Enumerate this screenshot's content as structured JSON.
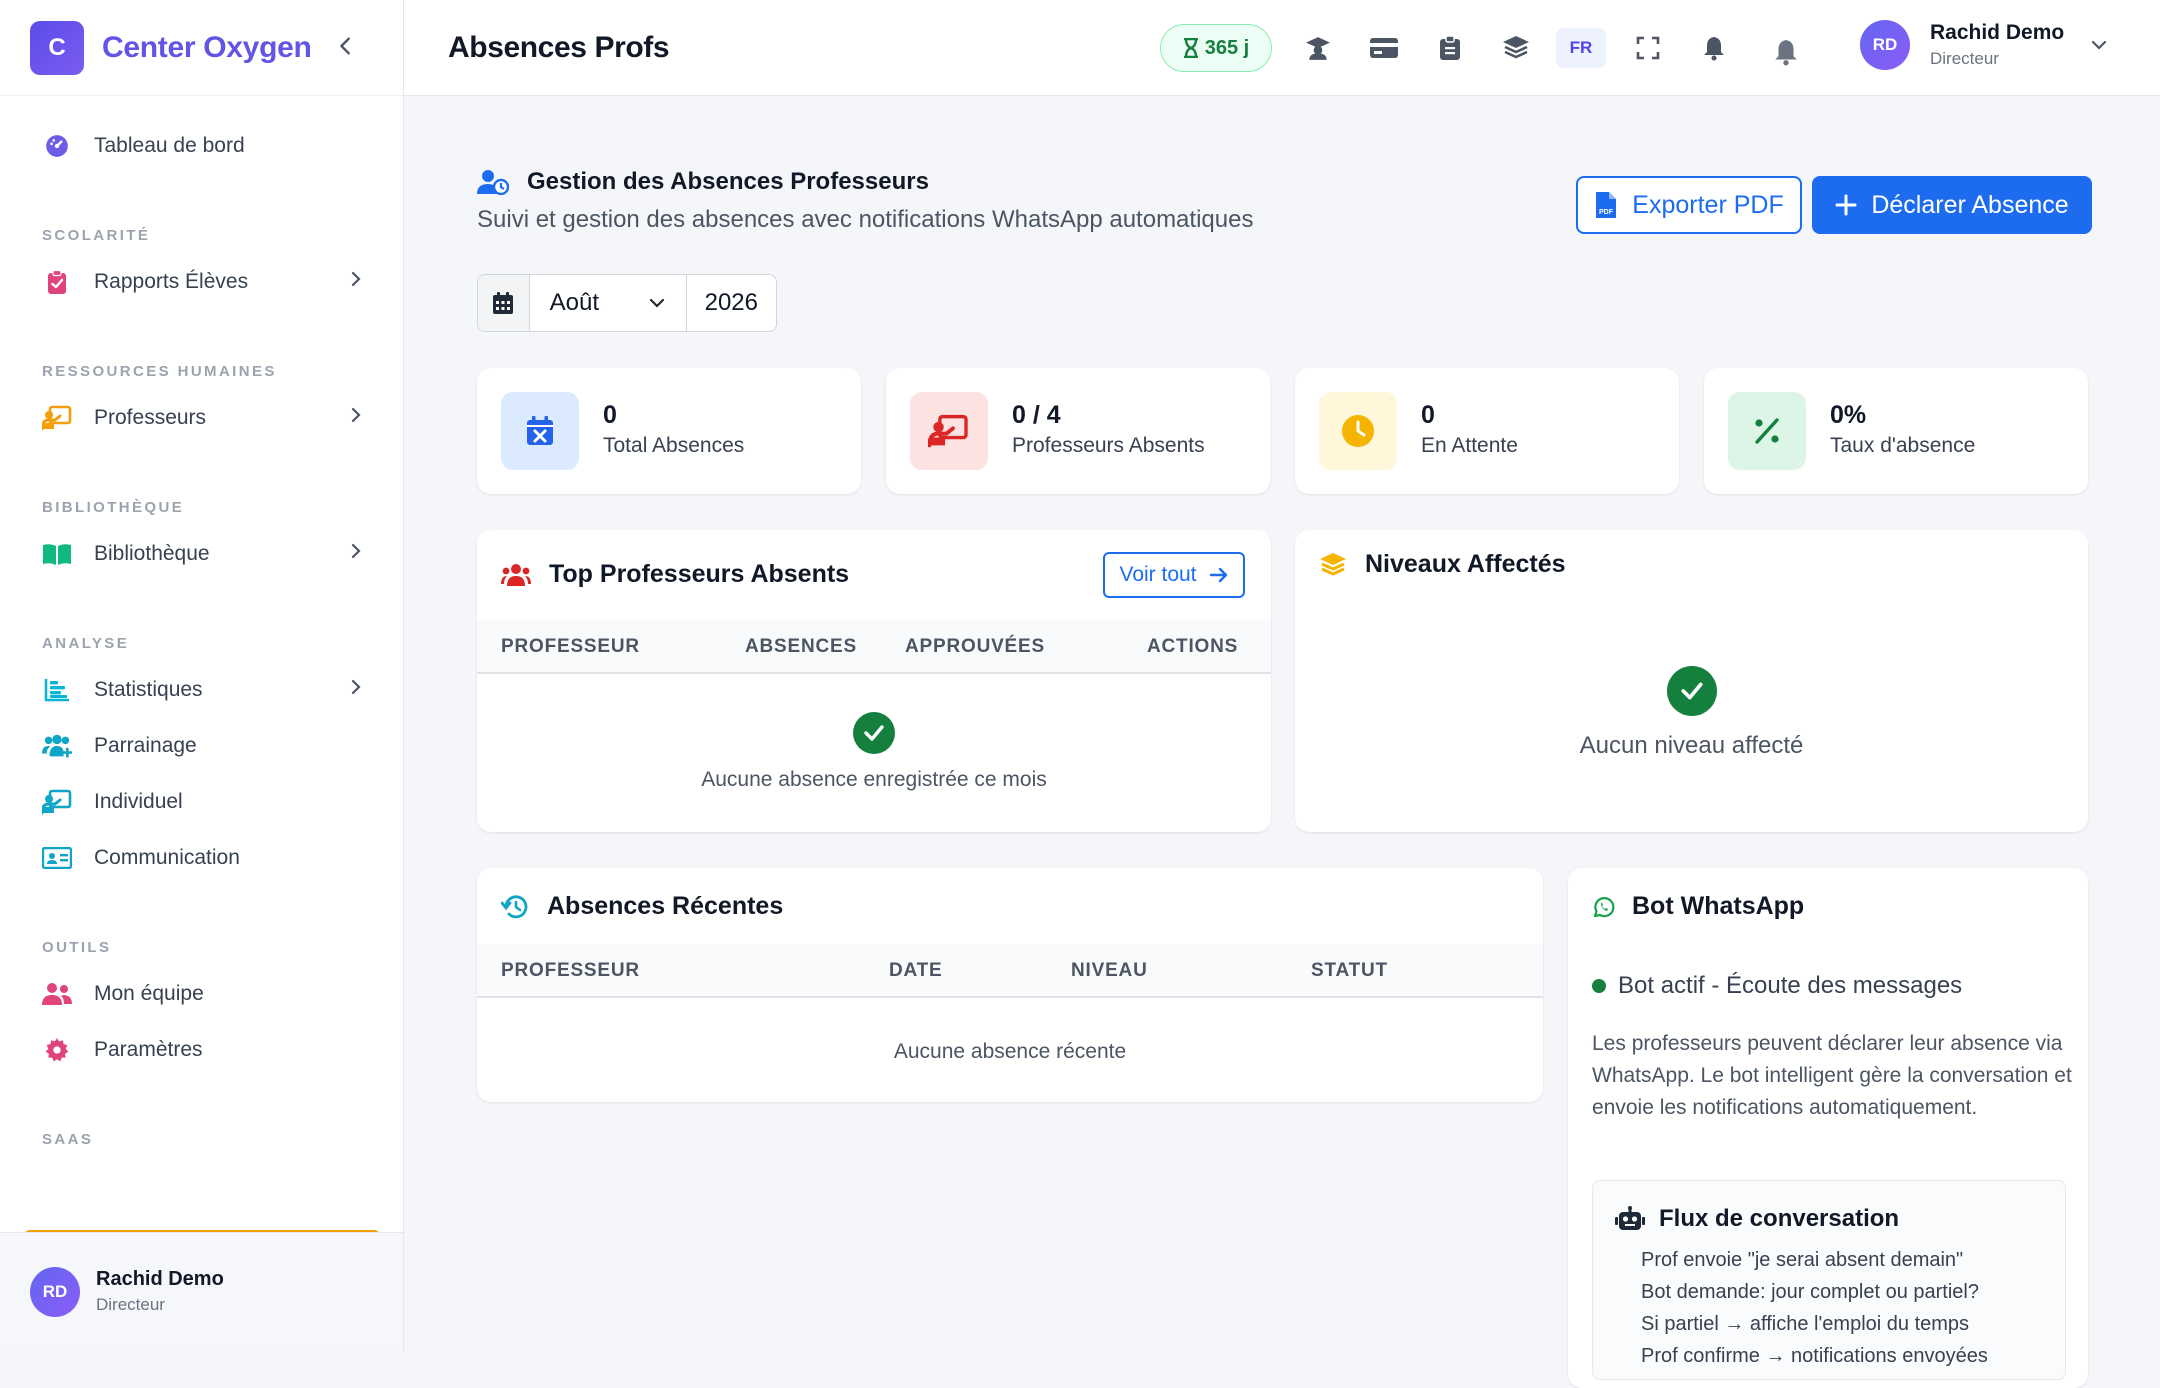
{
  "brand": {
    "initial": "C",
    "name": "Center Oxygen"
  },
  "sidebar": {
    "dashboard": "Tableau de bord",
    "sections": {
      "scolarite": "SCOLARITÉ",
      "rh": "RESSOURCES HUMAINES",
      "biblio": "BIBLIOTHÈQUE",
      "analyse": "ANALYSE",
      "outils": "OUTILS",
      "saas": "SAAS"
    },
    "items": {
      "rapports": "Rapports Élèves",
      "professeurs": "Professeurs",
      "bibliotheque": "Bibliothèque",
      "statistiques": "Statistiques",
      "parrainage": "Parrainage",
      "individuel": "Individuel",
      "communication": "Communication",
      "equipe": "Mon équipe",
      "parametres": "Paramètres"
    },
    "user": {
      "initials": "RD",
      "name": "Rachid Demo",
      "role": "Directeur"
    }
  },
  "topbar": {
    "title": "Absences Profs",
    "trial": "365 j",
    "lang": "FR",
    "user": {
      "initials": "RD",
      "name": "Rachid Demo",
      "role": "Directeur"
    }
  },
  "header": {
    "title": "Gestion des Absences Professeurs",
    "subtitle": "Suivi et gestion des absences avec notifications WhatsApp automatiques",
    "export": "Exporter PDF",
    "declare": "Déclarer Absence"
  },
  "filter": {
    "month": "Août",
    "year": "2026"
  },
  "stats": [
    {
      "value": "0",
      "label": "Total Absences",
      "color": "#2563eb"
    },
    {
      "value": "0 / 4",
      "label": "Professeurs Absents",
      "color": "#dc2626"
    },
    {
      "value": "0",
      "label": "En Attente",
      "color": "#f5b400"
    },
    {
      "value": "0%",
      "label": "Taux d'absence",
      "color": "#15803d"
    }
  ],
  "top_profs": {
    "title": "Top Professeurs Absents",
    "voir": "Voir tout",
    "columns": [
      "PROFESSEUR",
      "ABSENCES",
      "APPROUVÉES",
      "ACTIONS"
    ],
    "empty": "Aucune absence enregistrée ce mois"
  },
  "niveaux": {
    "title": "Niveaux Affectés",
    "empty": "Aucun niveau affecté"
  },
  "recent": {
    "title": "Absences Récentes",
    "columns": [
      "PROFESSEUR",
      "DATE",
      "NIVEAU",
      "STATUT"
    ],
    "empty": "Aucune absence récente"
  },
  "bot": {
    "title": "Bot WhatsApp",
    "status": "Bot actif - Écoute des messages",
    "description": "Les professeurs peuvent déclarer leur absence via WhatsApp. Le bot intelligent gère la conversation et envoie les notifications automatiquement.",
    "flux_title": "Flux de conversation",
    "flux": [
      "Prof envoie \"je serai absent demain\"",
      "Bot demande: jour complet ou partiel?",
      "Si partiel → affiche l'emploi du temps",
      "Prof confirme → notifications envoyées"
    ]
  }
}
